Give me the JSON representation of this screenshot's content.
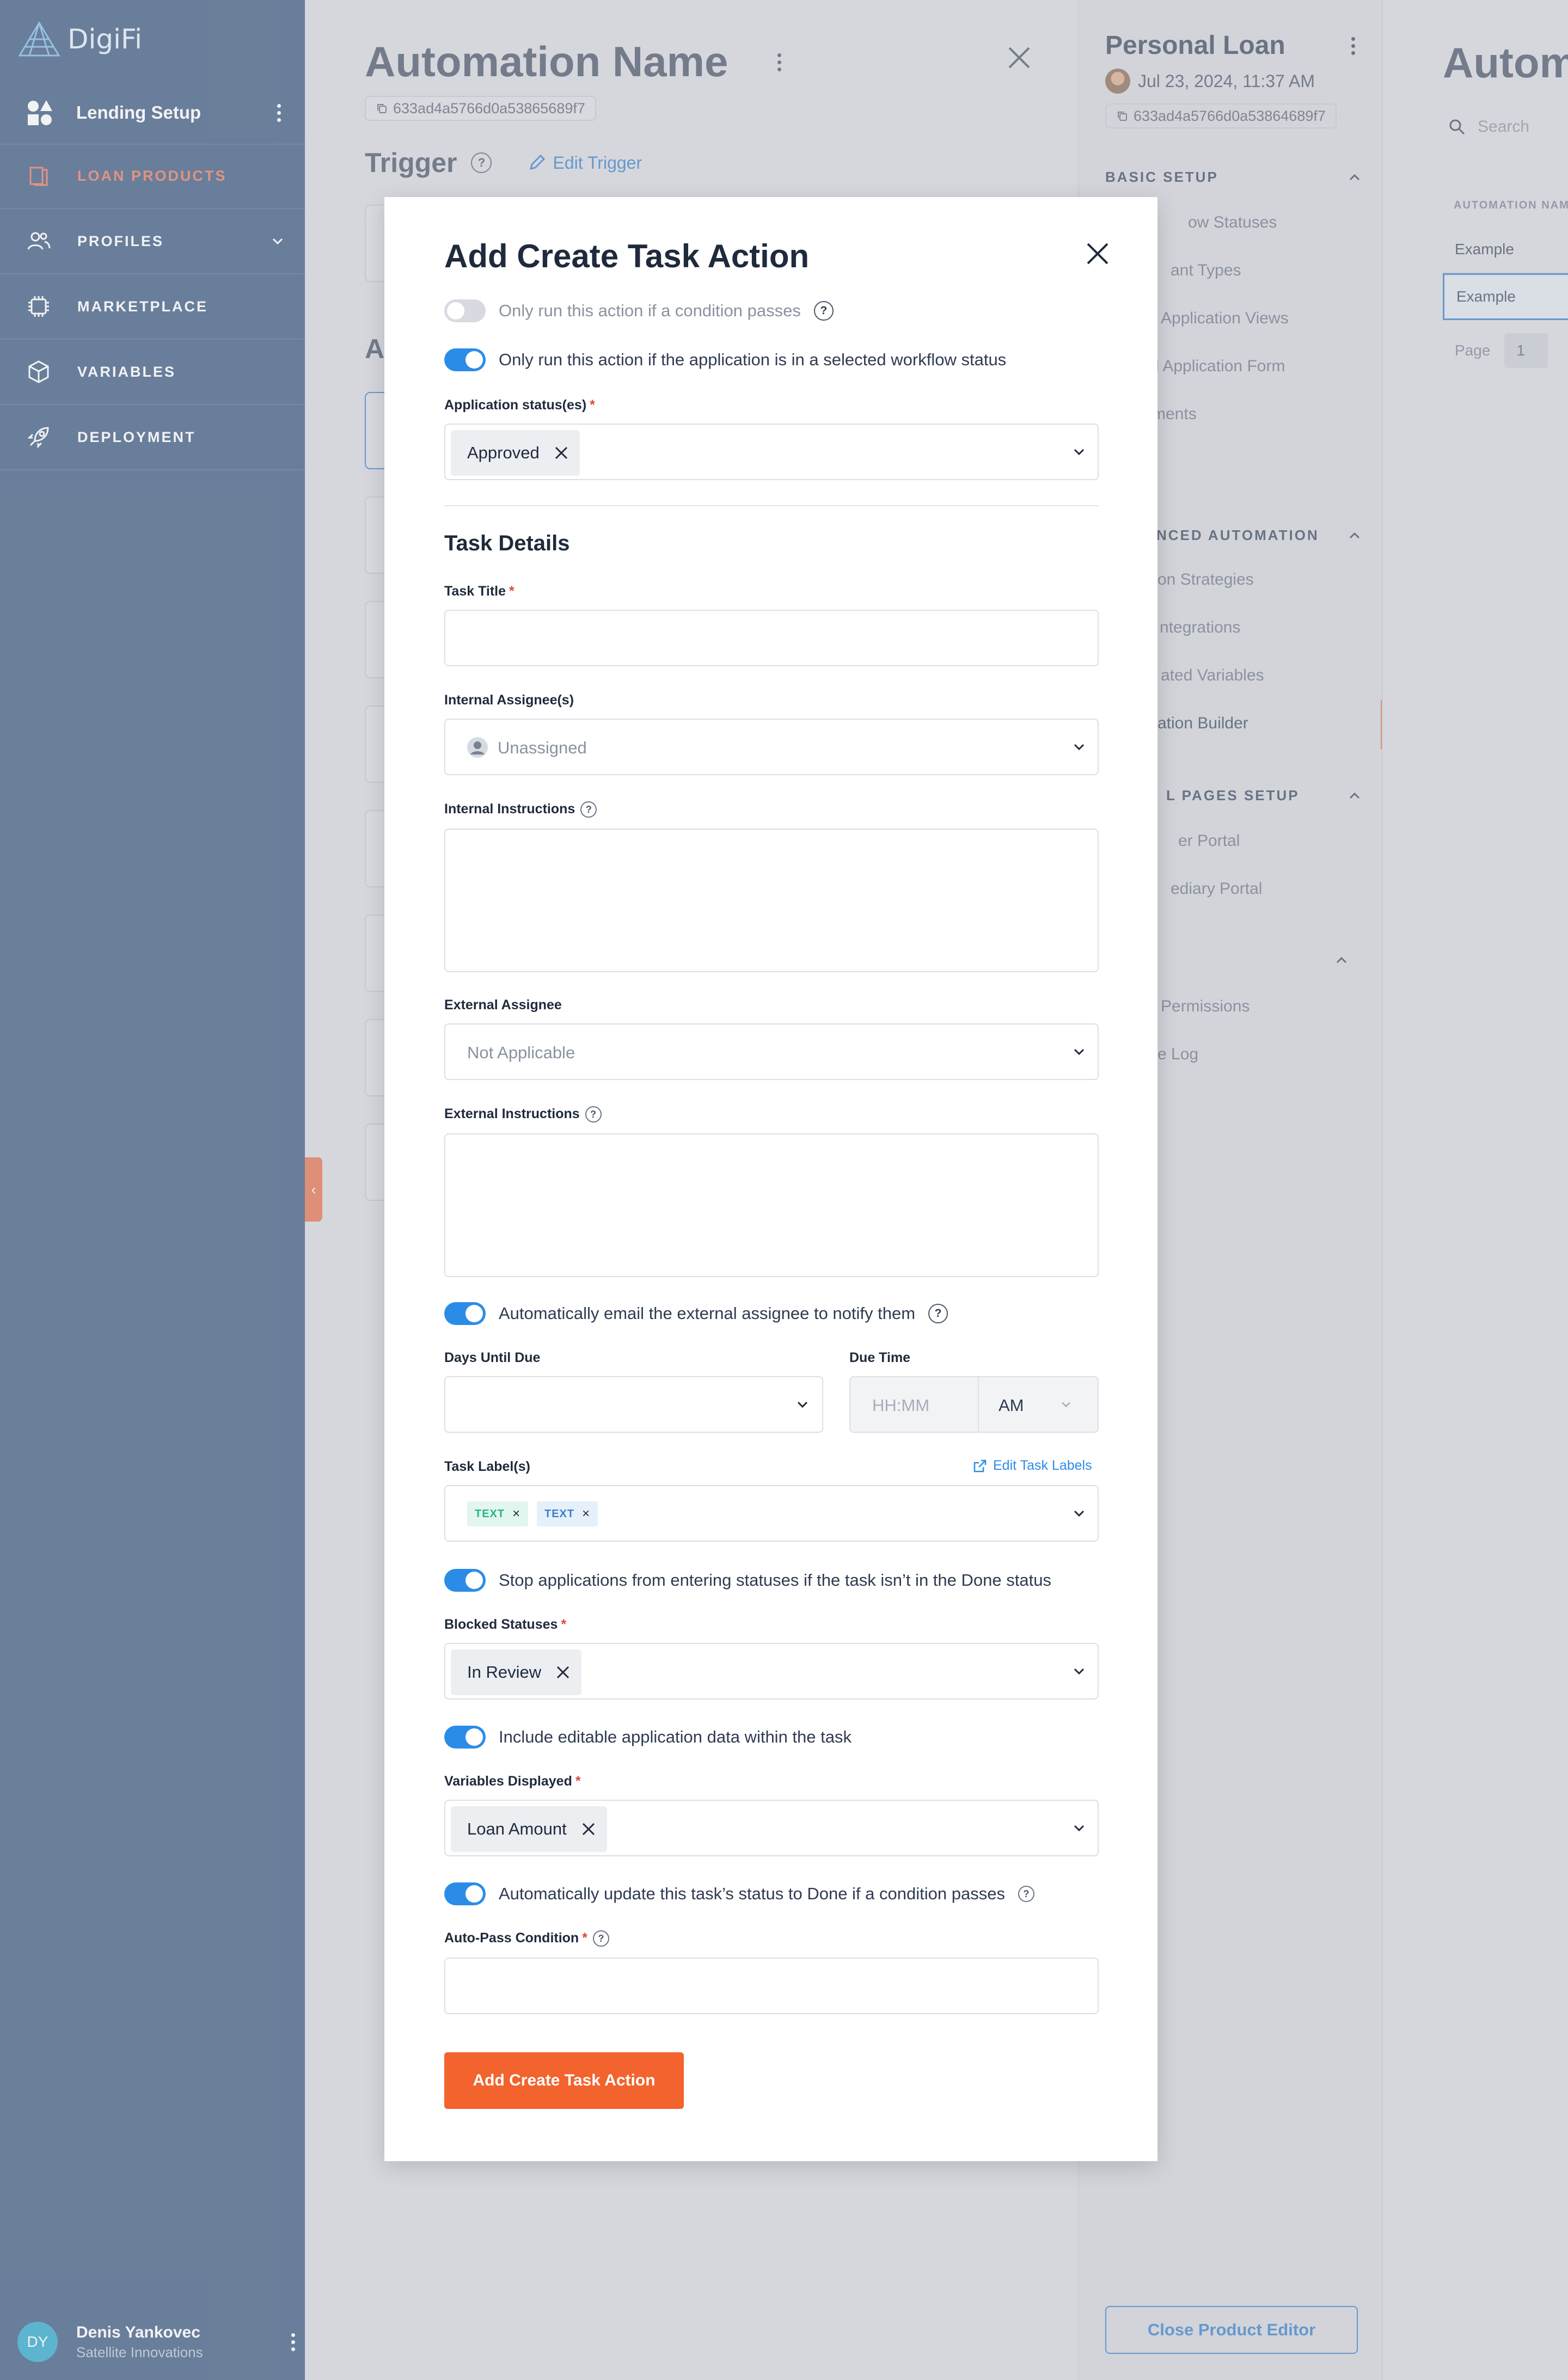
{
  "sidebar": {
    "logo_text": "DigiFi",
    "setup_label": "Lending Setup",
    "nav": [
      {
        "label": "LOAN PRODUCTS",
        "icon": "book-icon",
        "active": true
      },
      {
        "label": "PROFILES",
        "icon": "users-icon",
        "active": false
      },
      {
        "label": "MARKETPLACE",
        "icon": "chip-icon",
        "active": false
      },
      {
        "label": "VARIABLES",
        "icon": "cube-icon",
        "active": false
      },
      {
        "label": "DEPLOYMENT",
        "icon": "rocket-icon",
        "active": false
      }
    ],
    "user": {
      "initials": "DY",
      "name": "Denis Yankovec",
      "company": "Satellite Innovations"
    },
    "colors": {
      "bg": "#3d5a7f",
      "active": "#e8795b"
    }
  },
  "automation_panel": {
    "title": "Automation Name",
    "id": "633ad4a5766d0a53865689f7",
    "trigger_title": "Trigger",
    "edit_trigger": "Edit Trigger",
    "section_letter": "A"
  },
  "product_panel": {
    "title": "Personal Loan",
    "date": "Jul 23, 2024, 11:37 AM",
    "id": "633ad4a5766d0a53864689f7",
    "sections": [
      {
        "title": "BASIC SETUP",
        "items": [
          "ow Statuses",
          "ant Types",
          "Application Views",
          "l Application Form",
          "ments"
        ]
      },
      {
        "title": "NCED AUTOMATION",
        "items": [
          "on Strategies",
          "ntegrations",
          "ated Variables",
          "ation Builder"
        ]
      },
      {
        "title": "L PAGES SETUP",
        "items": [
          "er Portal",
          "ediary Portal"
        ]
      },
      {
        "title": "",
        "items": [
          "Permissions",
          "e Log"
        ]
      }
    ],
    "close_button": "Close Product Editor"
  },
  "far_panel": {
    "title": "Autom",
    "search_placeholder": "Search",
    "column_header": "AUTOMATION NAME",
    "rows": [
      "Example",
      "Example"
    ],
    "page_label": "Page",
    "page_value": "1"
  },
  "modal": {
    "title": "Add Create Task Action",
    "toggle_condition": "Only run this action if a condition passes",
    "toggle_status": "Only run this action if the application is in a selected workflow status",
    "app_status_label": "Application status(es)",
    "app_status_value": "Approved",
    "task_details_title": "Task Details",
    "task_title_label": "Task Title",
    "internal_assignee_label": "Internal Assignee(s)",
    "internal_assignee_placeholder": "Unassigned",
    "internal_instructions_label": "Internal Instructions",
    "external_assignee_label": "External Assignee",
    "external_assignee_placeholder": "Not Applicable",
    "external_instructions_label": "External Instructions",
    "toggle_email": "Automatically email the external assignee to notify them",
    "days_until_due_label": "Days Until Due",
    "due_time_label": "Due Time",
    "due_time_placeholder": "HH:MM",
    "due_time_ampm": "AM",
    "task_labels_label": "Task Label(s)",
    "edit_task_labels": "Edit Task Labels",
    "task_labels": [
      {
        "text": "TEXT",
        "color": "#24b48a"
      },
      {
        "text": "TEXT",
        "color": "#3a7fc8"
      }
    ],
    "toggle_block": "Stop applications from entering statuses if the task isn’t in the Done status",
    "blocked_statuses_label": "Blocked Statuses",
    "blocked_statuses_value": "In Review",
    "toggle_editable": "Include editable application data within the task",
    "variables_displayed_label": "Variables Displayed",
    "variables_displayed_value": "Loan Amount",
    "toggle_autopass": "Automatically update this task’s status to Done if a condition passes",
    "autopass_label": "Auto-Pass Condition",
    "submit_label": "Add Create Task Action",
    "colors": {
      "toggle_on": "#2b8ce8",
      "submit": "#f2632d",
      "required": "#e0473f"
    }
  }
}
